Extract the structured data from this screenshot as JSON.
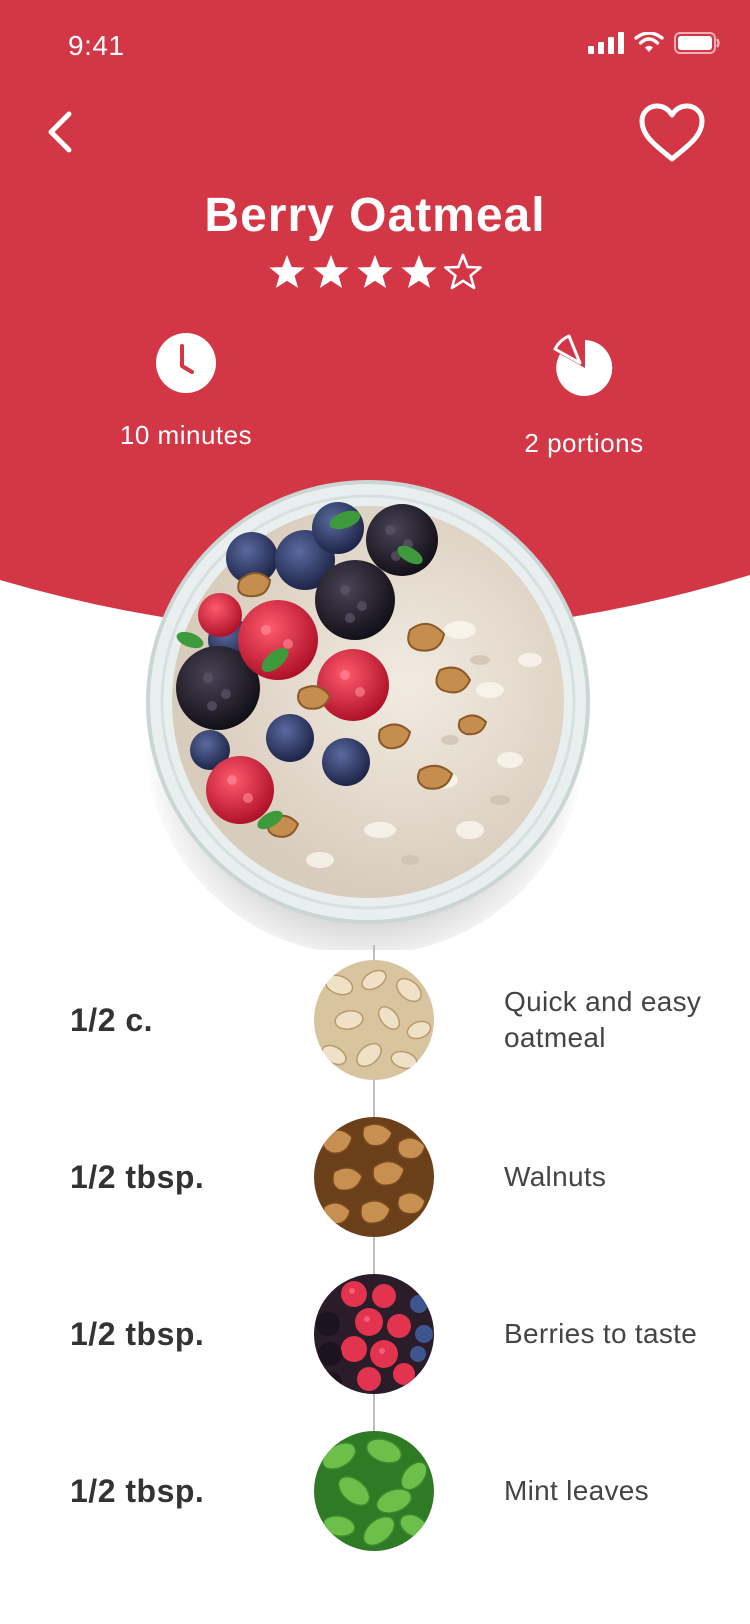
{
  "status_bar": {
    "time": "9:41"
  },
  "colors": {
    "accent": "#D33645",
    "text_dark": "#333333",
    "text_body": "#444444"
  },
  "recipe": {
    "title": "Berry Oatmeal",
    "rating": 4,
    "rating_max": 5,
    "time_label": "10 minutes",
    "portions_label": "2 portions"
  },
  "icons": {
    "back": "chevron-left-icon",
    "favorite": "heart-outline-icon",
    "time": "clock-icon",
    "portions": "pie-chart-icon"
  },
  "ingredients": [
    {
      "qty": "1/2 c.",
      "name": "Quick and easy oatmeal",
      "image": "oats-image"
    },
    {
      "qty": "1/2 tbsp.",
      "name": "Walnuts",
      "image": "walnuts-image"
    },
    {
      "qty": "1/2 tbsp.",
      "name": "Berries to taste",
      "image": "berries-image"
    },
    {
      "qty": "1/2 tbsp.",
      "name": "Mint leaves",
      "image": "mint-image"
    }
  ]
}
